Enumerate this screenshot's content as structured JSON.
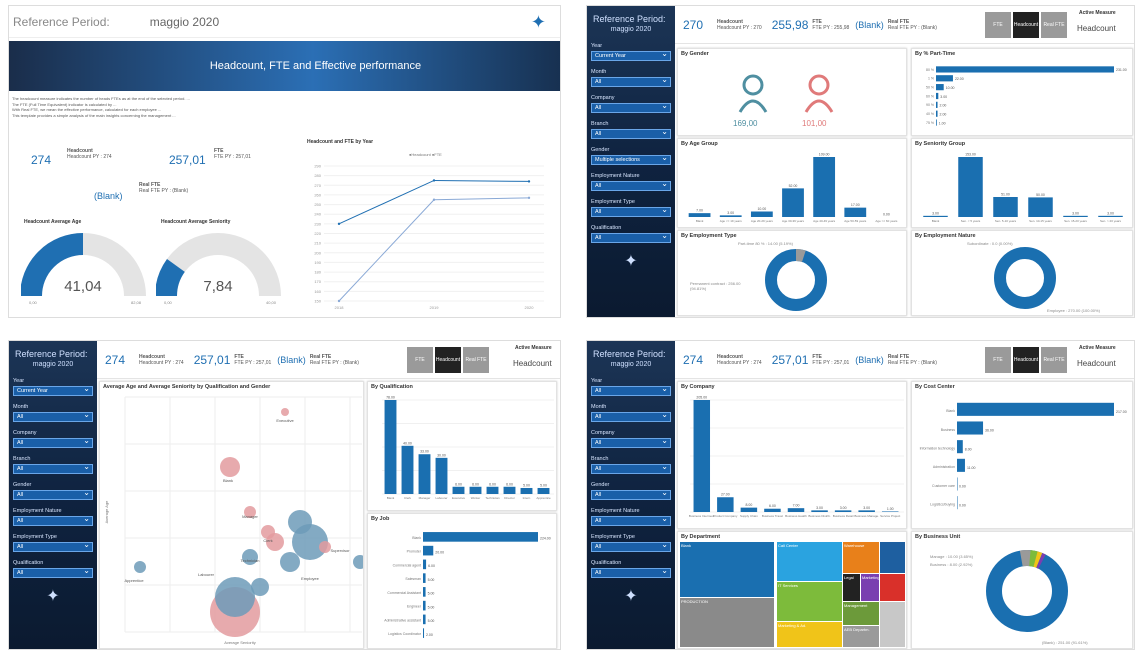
{
  "p1": {
    "ref_label": "Reference Period:",
    "ref_value": "maggio 2020",
    "banner": "Headcount, FTE and Effective performance",
    "desc": [
      "The headcount measure indicates the number of heads FTEs as at the end of the selected period. ...",
      "The FTE (Full Time Equivalent) indicator is calculated by ...",
      "With Real FTE, we mean the effective performance, calculated for each employee ...",
      "This template provides a simple analysis of the main insights concerning the management ..."
    ],
    "hc": "274",
    "hc_lbl": "Headcount",
    "hc_py_lbl": "Headcount PY :",
    "hc_py": "274",
    "fte": "257,01",
    "fte_lbl": "FTE",
    "fte_py_lbl": "FTE PY :",
    "fte_py": "257,01",
    "real": "(Blank)",
    "real_lbl": "Real FTE",
    "real_py_lbl": "Real FTE PY :",
    "real_py": "(Blank)",
    "age_title": "Headcount Average Age",
    "age_val": "41,04",
    "age_min": "0,00",
    "age_max": "82,08",
    "age_fraction": 0.5,
    "sen_title": "Headcount Average Seniority",
    "sen_val": "7,84",
    "sen_min": "0,00",
    "sen_max": "40,00",
    "sen_fraction": 0.2,
    "line_title": "Headcount and FTE by Year",
    "line_legend": "●Headcount ●FTE",
    "chart_data": {
      "type": "line",
      "title": "Headcount and FTE by Year",
      "x": [
        "2018",
        "2019",
        "2020"
      ],
      "series": [
        {
          "name": "Headcount",
          "values": [
            230,
            275,
            274
          ]
        },
        {
          "name": "FTE",
          "values": [
            150,
            255,
            257
          ]
        }
      ],
      "yticks": [
        "290",
        "280",
        "270",
        "260",
        "250",
        "240",
        "230",
        "220",
        "210",
        "200",
        "190",
        "180",
        "170",
        "160",
        "150"
      ],
      "ylim": [
        150,
        290
      ]
    }
  },
  "p2": {
    "ref_label": "Reference Period:",
    "ref_value": "maggio 2020",
    "hc": "270",
    "hc_lbl": "Headcount",
    "hc_py_lbl": "Headcount PY :",
    "hc_py": "270",
    "fte": "255,98",
    "fte_lbl": "FTE",
    "fte_py_lbl": "FTE PY :",
    "fte_py": "255,98",
    "real": "(Blank)",
    "real_lbl": "Real FTE",
    "real_py_lbl": "Real FTE PY :",
    "real_py": "(Blank)",
    "btn1": "FTE",
    "btn2": "Headcount",
    "btn3": "Real FTE",
    "active_lbl": "Active Measure",
    "active_val": "Headcount",
    "filters": [
      {
        "l": "Year",
        "v": "Current Year"
      },
      {
        "l": "Month",
        "v": "All"
      },
      {
        "l": "Company",
        "v": "All"
      },
      {
        "l": "Branch",
        "v": "All"
      },
      {
        "l": "Gender",
        "v": "Multiple selections"
      },
      {
        "l": "Employment Nature",
        "v": "All"
      },
      {
        "l": "Employment Type",
        "v": "All"
      },
      {
        "l": "Qualification",
        "v": "All"
      }
    ],
    "gender_title": "By Gender",
    "male": "169,00",
    "female": "101,00",
    "pt_title": "By % Part-Time",
    "pt_chart": {
      "type": "bar",
      "categories": [
        "80 %",
        "1 %",
        "50 %",
        "60 %",
        "90 %",
        "40 %",
        "75 %"
      ],
      "values": [
        231,
        22,
        10,
        3,
        2,
        2,
        1
      ]
    },
    "age_title": "By Age Group",
    "age_chart": {
      "type": "bar",
      "categories": [
        "Blank",
        "Age <= 19 years",
        "Age 20-29 years",
        "Age 30-39 years",
        "Age 40-49 years",
        "Age 50-59 years",
        "Age >= 60 years"
      ],
      "values": [
        7,
        3,
        10,
        52,
        109,
        17,
        0
      ]
    },
    "sen_title": "By Seniority Group",
    "sen_chart": {
      "type": "bar",
      "categories": [
        "Blank",
        "Sen. < 5 years",
        "Sen. 5-10 years",
        "Sen. 10-15 years",
        "Sen. 15-20 years",
        "Sen. > 20 years"
      ],
      "values": [
        3,
        153,
        51,
        50,
        3,
        3
      ]
    },
    "emp_title": "By Employment Type",
    "emp_l1": "Part-time 80 % : 14.00 (5.19%)",
    "emp_l2": "Permanent contract : 256.00 (94.81%)",
    "nat_title": "By Employment Nature",
    "nat_l1": "Subordinate : 0.0 (0.00%)",
    "nat_l2": "Employee : 270.00 (100.00%)"
  },
  "p3": {
    "ref_label": "Reference Period:",
    "ref_value": "maggio 2020",
    "hc": "274",
    "hc_lbl": "Headcount",
    "hc_py_lbl": "Headcount PY :",
    "hc_py": "274",
    "fte": "257,01",
    "fte_lbl": "FTE",
    "fte_py_lbl": "FTE PY :",
    "fte_py": "257,01",
    "real": "(Blank)",
    "real_lbl": "Real FTE",
    "real_py_lbl": "Real FTE PY :",
    "real_py": "(Blank)",
    "btn1": "FTE",
    "btn2": "Headcount",
    "btn3": "Real FTE",
    "active_lbl": "Active Measure",
    "active_val": "Headcount",
    "filters": [
      {
        "l": "Year",
        "v": "Current Year"
      },
      {
        "l": "Month",
        "v": "All"
      },
      {
        "l": "Company",
        "v": "All"
      },
      {
        "l": "Branch",
        "v": "All"
      },
      {
        "l": "Gender",
        "v": "All"
      },
      {
        "l": "Employment Nature",
        "v": "All"
      },
      {
        "l": "Employment Type",
        "v": "All"
      },
      {
        "l": "Qualification",
        "v": "All"
      }
    ],
    "scatter_title": "Average Age and Average Seniority by Qualification and Gender",
    "scatter_xlabel": "Average Seniority",
    "scatter_ylabel": "Average Age",
    "qual_title": "By Qualification",
    "qual_chart": {
      "type": "bar",
      "categories": [
        "Blank",
        "Clerk",
        "Manager",
        "Labourer",
        "Executive",
        "Worker",
        "Technician",
        "Director",
        "Intern",
        "Apprentice"
      ],
      "values": [
        78,
        40,
        33,
        30,
        6,
        6,
        6,
        6,
        5,
        5
      ]
    },
    "job_title": "By Job",
    "job_chart": {
      "type": "bar",
      "categories": [
        "Blank",
        "Promoter",
        "Commercial agent",
        "Salesman",
        "Commercial Assistant",
        "Engineer",
        "Administrative assistant",
        "Logistics Coordinator"
      ],
      "values": [
        224,
        20,
        6,
        5,
        5,
        5,
        5,
        2
      ]
    },
    "bubble_labels": [
      "Executive",
      "Blank",
      "Manager",
      "Clerk",
      "Technician",
      "Employee",
      "Supervisor",
      "Apprentice",
      "Labourer"
    ]
  },
  "p4": {
    "ref_label": "Reference Period:",
    "ref_value": "maggio 2020",
    "hc": "274",
    "hc_lbl": "Headcount",
    "hc_py_lbl": "Headcount PY :",
    "hc_py": "274",
    "fte": "257,01",
    "fte_lbl": "FTE",
    "fte_py_lbl": "FTE PY :",
    "fte_py": "257,01",
    "real": "(Blank)",
    "real_lbl": "Real FTE",
    "real_py_lbl": "Real FTE PY :",
    "real_py": "(Blank)",
    "btn1": "FTE",
    "btn2": "Headcount",
    "btn3": "Real FTE",
    "active_lbl": "Active Measure",
    "active_val": "Headcount",
    "filters": [
      {
        "l": "Year",
        "v": "All"
      },
      {
        "l": "Month",
        "v": "All"
      },
      {
        "l": "Company",
        "v": "All"
      },
      {
        "l": "Branch",
        "v": "All"
      },
      {
        "l": "Gender",
        "v": "All"
      },
      {
        "l": "Employment Nature",
        "v": "All"
      },
      {
        "l": "Employment Type",
        "v": "All"
      },
      {
        "l": "Qualification",
        "v": "All"
      }
    ],
    "comp_title": "By Company",
    "comp_chart": {
      "type": "bar",
      "categories": [
        "Business Intermed.",
        "Product Company",
        "Supply Chain",
        "Business Travel",
        "Business Health",
        "Business Distrib.",
        "Business Retail",
        "Business Manage.",
        "Service Project"
      ],
      "values": [
        205,
        27,
        8,
        6,
        7,
        3,
        3,
        3,
        1
      ]
    },
    "cc_title": "By Cost Center",
    "cc_chart": {
      "type": "bar",
      "categories": [
        "Blank",
        "Business",
        "Information technology",
        "Administration",
        "Customer care",
        "Logistics/buying"
      ],
      "values": [
        217,
        36,
        8,
        11,
        0,
        0
      ]
    },
    "dept_title": "By Department",
    "dept_labels": [
      "Blank",
      "PRODUCTION",
      "Call Center",
      "IT Services",
      "Marketing & Ad.",
      "Warehouse",
      "Legal",
      "Marketing",
      "Management",
      "AEB Departm."
    ],
    "bu_title": "By Business Unit",
    "bu_l1": "Manage : 10.00 (3.65%)",
    "bu_l2": "Business : 8.00 (2.92%)",
    "bu_l3": "(Blank) : 251.00 (91.61%)"
  }
}
